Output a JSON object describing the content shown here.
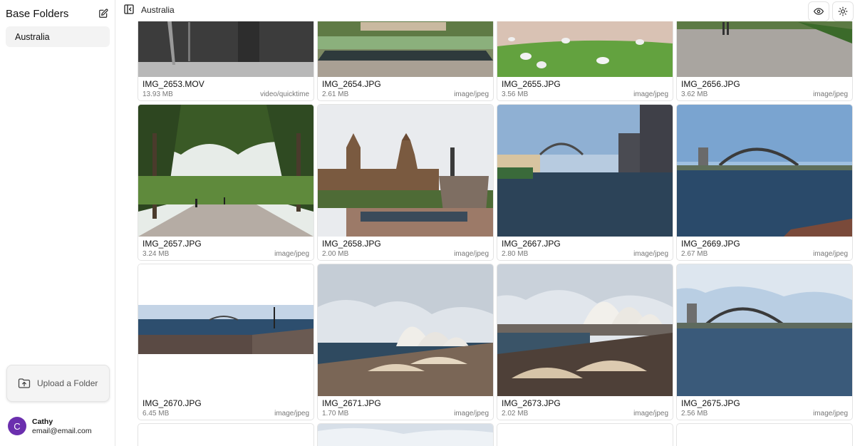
{
  "sidebar": {
    "title": "Base Folders",
    "folders": [
      {
        "label": "Australia"
      }
    ],
    "upload_label": "Upload a Folder",
    "user": {
      "initial": "C",
      "name": "Cathy",
      "email": "email@email.com"
    }
  },
  "topbar": {
    "breadcrumb": "Australia"
  },
  "files": [
    {
      "name": "IMG_2653.MOV",
      "size": "13.93 MB",
      "type": "video/quicktime"
    },
    {
      "name": "IMG_2654.JPG",
      "size": "2.61 MB",
      "type": "image/jpeg"
    },
    {
      "name": "IMG_2655.JPG",
      "size": "3.56 MB",
      "type": "image/jpeg"
    },
    {
      "name": "IMG_2656.JPG",
      "size": "3.62 MB",
      "type": "image/jpeg"
    },
    {
      "name": "IMG_2657.JPG",
      "size": "3.24 MB",
      "type": "image/jpeg"
    },
    {
      "name": "IMG_2658.JPG",
      "size": "2.00 MB",
      "type": "image/jpeg"
    },
    {
      "name": "IMG_2667.JPG",
      "size": "2.80 MB",
      "type": "image/jpeg"
    },
    {
      "name": "IMG_2669.JPG",
      "size": "2.67 MB",
      "type": "image/jpeg"
    },
    {
      "name": "IMG_2670.JPG",
      "size": "6.45 MB",
      "type": "image/jpeg"
    },
    {
      "name": "IMG_2671.JPG",
      "size": "1.70 MB",
      "type": "image/jpeg"
    },
    {
      "name": "IMG_2673.JPG",
      "size": "2.02 MB",
      "type": "image/jpeg"
    },
    {
      "name": "IMG_2675.JPG",
      "size": "2.56 MB",
      "type": "image/jpeg"
    }
  ],
  "icons": {
    "edit": "pencil-square-icon",
    "collapse": "sidebar-collapse-icon",
    "eye": "eye-icon",
    "theme": "sun-icon",
    "upload": "folder-upload-icon"
  },
  "colors": {
    "avatar": "#6b2fae"
  }
}
